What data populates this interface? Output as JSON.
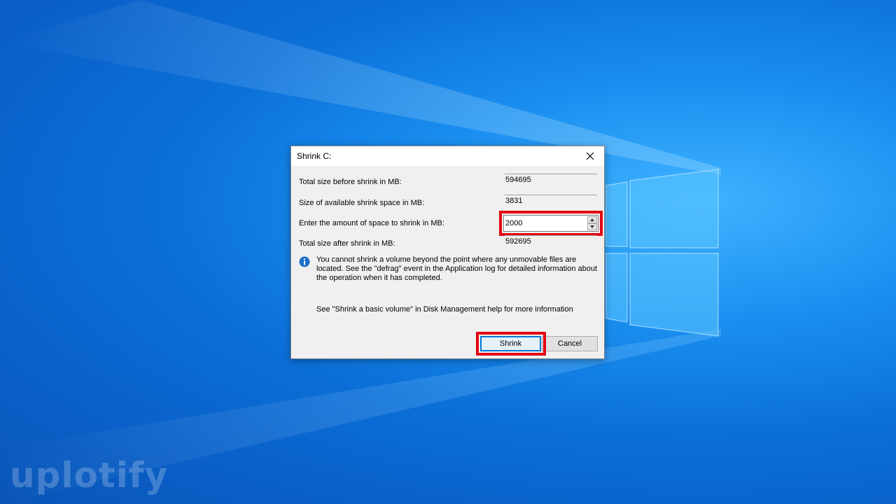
{
  "dialog": {
    "title": "Shrink C:",
    "rows": {
      "total_before": {
        "label": "Total size before shrink in MB:",
        "value": "594695"
      },
      "available": {
        "label": "Size of available shrink space in MB:",
        "value": "3831"
      },
      "amount": {
        "label": "Enter the amount of space to shrink in MB:",
        "value": "2000"
      },
      "total_after": {
        "label": "Total size after shrink in MB:",
        "value": "592695"
      }
    },
    "info_text": "You cannot shrink a volume beyond the point where any unmovable files are located. See the \"defrag\" event in the Application log for detailed information about the operation when it has completed.",
    "help_text": "See \"Shrink a basic volume\" in Disk Management help for more information",
    "buttons": {
      "shrink": "Shrink",
      "cancel": "Cancel"
    }
  },
  "watermark": "uplotify",
  "colors": {
    "highlight": "#e30613",
    "accent": "#0078d7",
    "desktop": "#0b6fd8"
  }
}
